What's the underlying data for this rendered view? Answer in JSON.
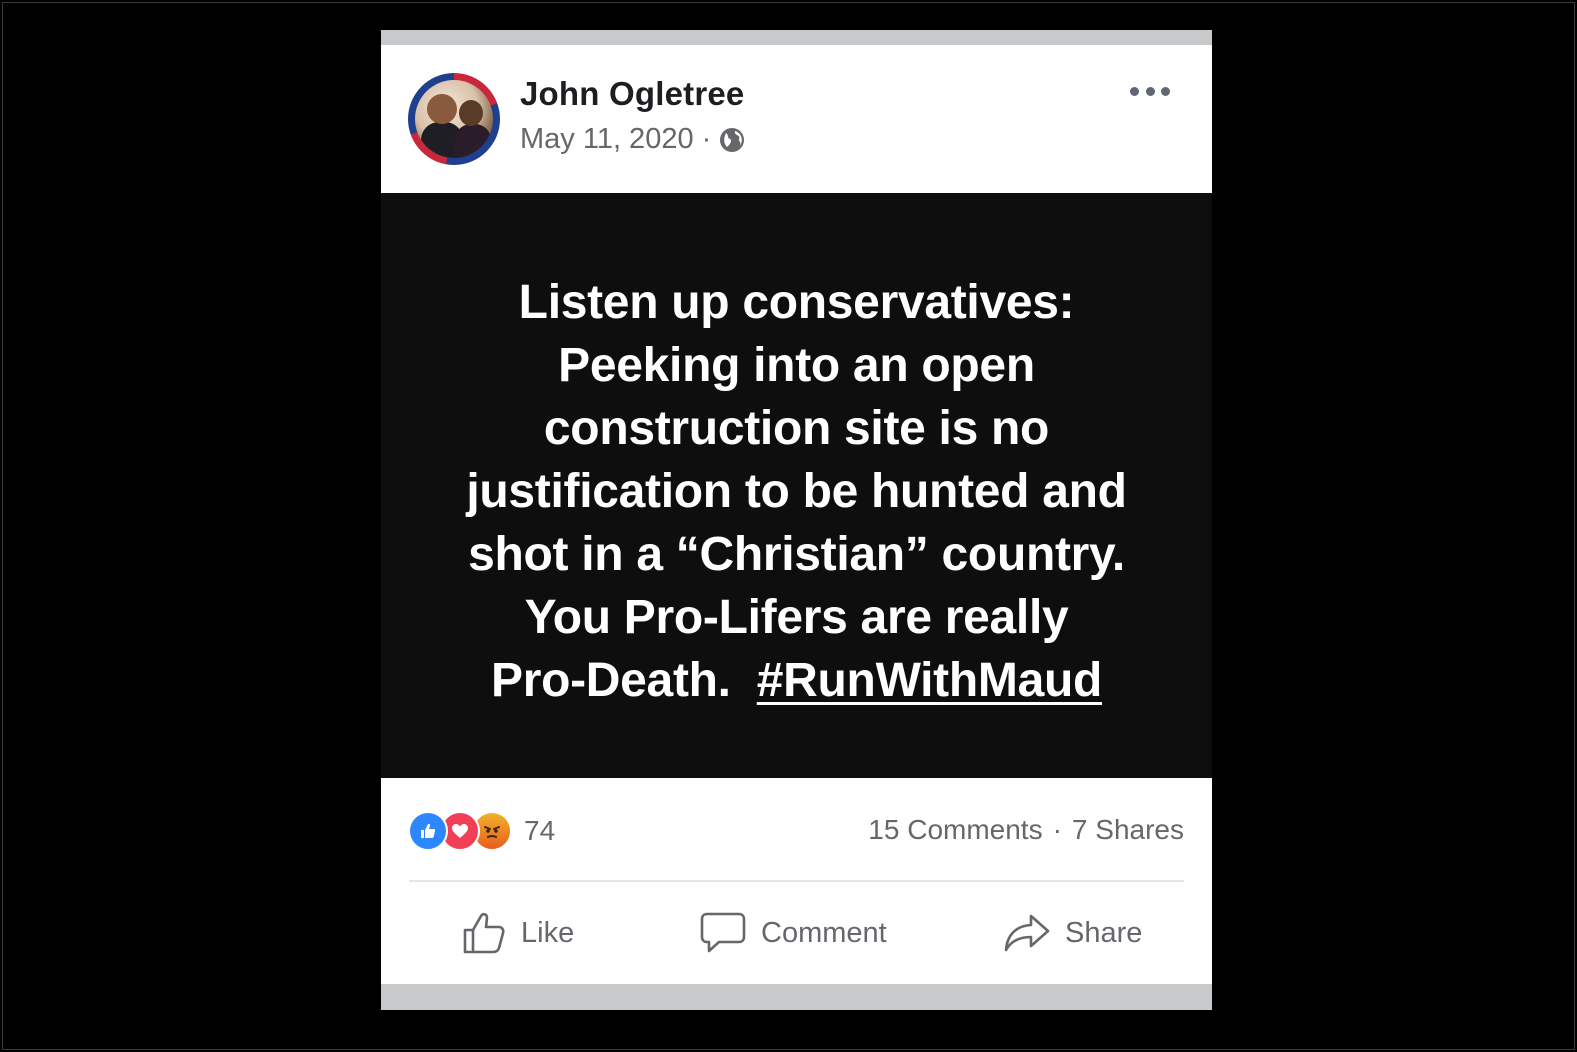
{
  "post": {
    "author": "John Ogletree",
    "date": "May 11, 2020",
    "separator": "·",
    "privacy_icon": "globe-icon",
    "avatar_icon": "profile-photo"
  },
  "content": {
    "lines": [
      "Listen up conservatives:",
      "Peeking into an open",
      "construction site is no",
      "justification to be hunted and",
      "shot in a “Christian” country.",
      "You Pro-Lifers are really"
    ],
    "last_line_prefix": "Pro-Death.  ",
    "hashtag": "#RunWithMaud"
  },
  "summary": {
    "reaction_icons": [
      "like-reaction-icon",
      "love-reaction-icon",
      "angry-reaction-icon"
    ],
    "reaction_count": "74",
    "comments": "15 Comments",
    "separator": "·",
    "shares": "7 Shares"
  },
  "actions": {
    "like_label": "Like",
    "comment_label": "Comment",
    "share_label": "Share"
  },
  "colors": {
    "background": "#000000",
    "card": "#ffffff",
    "post_image_bg": "#0e0e0e",
    "meta_text": "#65676b",
    "like_blue": "#2d88ff",
    "love_red": "#f33e58",
    "angry_orange": "#e85d1b"
  }
}
